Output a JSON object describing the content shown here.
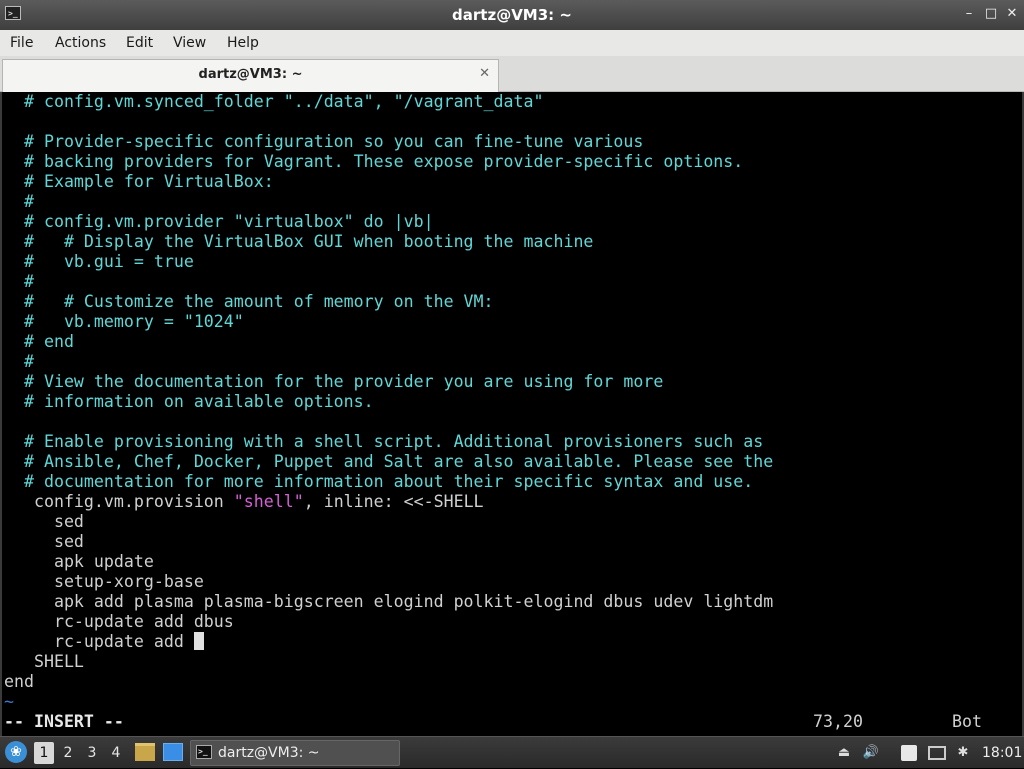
{
  "window": {
    "title": "dartz@VM3: ~",
    "app_icon": "terminal-icon",
    "controls": [
      "_",
      "□",
      "✕"
    ]
  },
  "menu": [
    "File",
    "Actions",
    "Edit",
    "View",
    "Help"
  ],
  "tab": {
    "label": "dartz@VM3: ~",
    "close": "✕"
  },
  "terminal": {
    "lines": [
      [
        {
          "t": "  # config.vm.synced_folder \"../data\", \"/vagrant_data\"",
          "c": "comment"
        }
      ],
      [],
      [
        {
          "t": "  # Provider-specific configuration so you can fine-tune various",
          "c": "comment"
        }
      ],
      [
        {
          "t": "  # backing providers for Vagrant. These expose provider-specific options.",
          "c": "comment"
        }
      ],
      [
        {
          "t": "  # Example for VirtualBox:",
          "c": "comment"
        }
      ],
      [
        {
          "t": "  #",
          "c": "comment"
        }
      ],
      [
        {
          "t": "  # config.vm.provider \"virtualbox\" do |vb|",
          "c": "comment"
        }
      ],
      [
        {
          "t": "  #   # Display the VirtualBox GUI when booting the machine",
          "c": "comment"
        }
      ],
      [
        {
          "t": "  #   vb.gui = true",
          "c": "comment"
        }
      ],
      [
        {
          "t": "  #",
          "c": "comment"
        }
      ],
      [
        {
          "t": "  #   # Customize the amount of memory on the VM:",
          "c": "comment"
        }
      ],
      [
        {
          "t": "  #   vb.memory = \"1024\"",
          "c": "comment"
        }
      ],
      [
        {
          "t": "  # end",
          "c": "comment"
        }
      ],
      [
        {
          "t": "  #",
          "c": "comment"
        }
      ],
      [
        {
          "t": "  # View the documentation for the provider you are using for more",
          "c": "comment"
        }
      ],
      [
        {
          "t": "  # information on available options.",
          "c": "comment"
        }
      ],
      [],
      [
        {
          "t": "  # Enable provisioning with a shell script. Additional provisioners such as",
          "c": "comment"
        }
      ],
      [
        {
          "t": "  # Ansible, Chef, Docker, Puppet and Salt are also available. Please see the",
          "c": "comment"
        }
      ],
      [
        {
          "t": "  # documentation for more information about their specific syntax and use.",
          "c": "comment"
        }
      ],
      [
        {
          "t": "   config.vm.provision ",
          "c": "code"
        },
        {
          "t": "\"shell\"",
          "c": "string"
        },
        {
          "t": ", inline: <<-SHELL",
          "c": "code"
        }
      ],
      [
        {
          "t": "     sed",
          "c": "code"
        }
      ],
      [
        {
          "t": "     sed",
          "c": "code"
        }
      ],
      [
        {
          "t": "     apk update",
          "c": "code"
        }
      ],
      [
        {
          "t": "     setup-xorg-base",
          "c": "code"
        }
      ],
      [
        {
          "t": "     apk add plasma plasma-bigscreen elogind polkit-elogind dbus udev lightdm",
          "c": "code"
        }
      ],
      [
        {
          "t": "     rc-update add dbus",
          "c": "code"
        }
      ],
      [
        {
          "t": "     rc-update add ",
          "c": "code"
        },
        {
          "t": "",
          "c": "cursor"
        }
      ],
      [
        {
          "t": "   SHELL",
          "c": "code"
        }
      ],
      [
        {
          "t": "end",
          "c": "code"
        }
      ],
      [
        {
          "t": "~",
          "c": "tilde"
        }
      ]
    ],
    "status": {
      "mode": "-- INSERT --",
      "position": "73,20",
      "scroll": "Bot"
    }
  },
  "taskbar": {
    "start_icon": "start-menu-icon",
    "workspaces": [
      "1",
      "2",
      "3",
      "4"
    ],
    "active_workspace": "1",
    "launchers": [
      "file-manager-icon",
      "show-desktop-icon"
    ],
    "task": {
      "label": "dartz@VM3: ~",
      "icon": "terminal-icon"
    },
    "tray_icons": [
      "eject-icon",
      "volume-icon",
      "clipboard-icon",
      "network-icon",
      "bluetooth-icon"
    ],
    "clock": "18:01"
  }
}
